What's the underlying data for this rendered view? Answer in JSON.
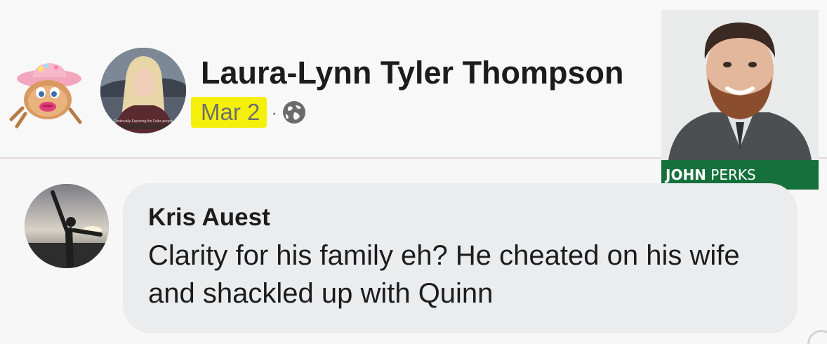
{
  "post": {
    "author_name": "Laura-Lynn Tyler Thompson",
    "date": "Mar 2",
    "separator": "·",
    "audience_icon": "globe-icon",
    "avatar_caption": "Continually Exposing the False people"
  },
  "overlay": {
    "caption_first": "JOHN",
    "caption_last": "PERKS"
  },
  "comment": {
    "author_name": "Kris Auest",
    "text": "Clarity for his family eh? He cheated on his wife and shackled up with Quinn"
  },
  "colors": {
    "date_highlight": "#f4f00a",
    "caption_bar": "#16703c",
    "bubble": "#ebecee"
  }
}
